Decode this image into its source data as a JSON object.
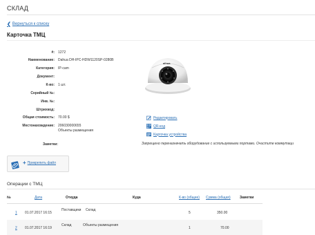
{
  "header": {
    "title": "СКЛАД"
  },
  "nav": {
    "back_label": "Вернуться к списку"
  },
  "card": {
    "title": "Карточка ТМЦ",
    "fields": [
      {
        "label": "#:",
        "value": "1272"
      },
      {
        "label": "Наименование:",
        "value": "Dahua DH-IPC-HDW1120SP-0280B"
      },
      {
        "label": "Категория:",
        "value": "IP-cam"
      },
      {
        "label": "Документ:",
        "value": ""
      },
      {
        "label": "К-во:",
        "value": "1 шт."
      },
      {
        "label": "Серийный №:",
        "value": ""
      },
      {
        "label": "Инв. №:",
        "value": ""
      },
      {
        "label": "Штрихкод:",
        "value": ""
      },
      {
        "label": "Общая стоимость:",
        "value": "70.00 $"
      },
      {
        "label": "Местонахождение:",
        "value": "206030000655",
        "value2": "Объекты размещения"
      }
    ],
    "notes_label": "Заметки:",
    "image_brand": "alhua"
  },
  "actions": {
    "edit": "Редактировать",
    "qr": "QR-код",
    "device_card": "Карточка устройства",
    "warning": "Запрещено переназначать оборудование с используемыми портами. Очистите коммутаци"
  },
  "attach": {
    "label": "Прикрепить файл"
  },
  "operations": {
    "title": "Операции с ТМЦ",
    "columns": {
      "num": "№",
      "date": "Дата",
      "from": "Откуда",
      "to": "Куда",
      "qty": "К-во (общее)",
      "sum": "Сумма (общая)",
      "notes": "Заметки"
    },
    "rows": [
      {
        "num": "1",
        "date": "01.07.2017 16:15",
        "from": "Поставщики",
        "to": "Склад",
        "qty": "5",
        "sum": "350.00"
      },
      {
        "num": "2",
        "date": "01.07.2017 16:19",
        "from": "Склад",
        "to": "Объекты размещения",
        "qty": "1",
        "sum": "70.00"
      }
    ]
  },
  "colors": {
    "link": "#2a6fb5",
    "text": "#333333"
  }
}
